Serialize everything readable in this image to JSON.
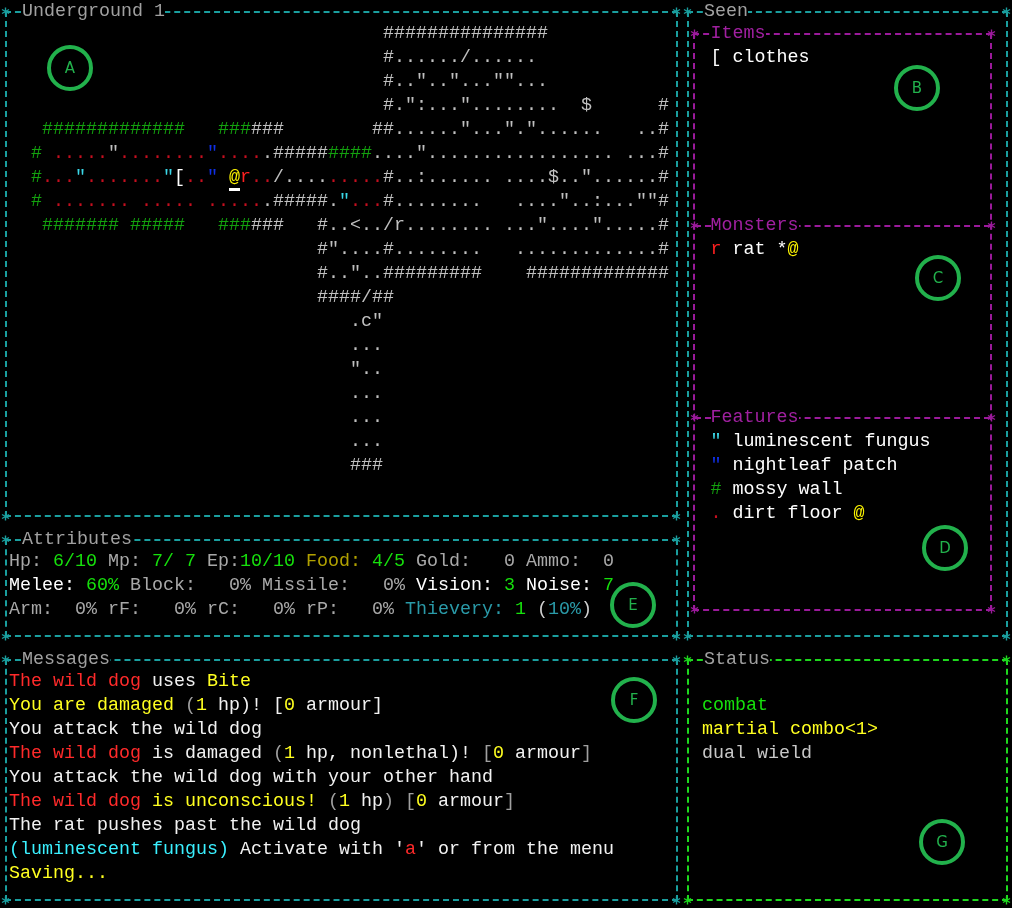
{
  "map_panel": {
    "title": "Underground 1",
    "callout": "A",
    "rows": [
      {
        "segments": [
          {
            "text": "                                  ###############",
            "color": "#c0c0c0"
          }
        ]
      },
      {
        "segments": [
          {
            "text": "                                  #....../......",
            "color": "#c0c0c0"
          }
        ]
      },
      {
        "segments": [
          {
            "text": "                                  #..\"..\"...\"\"...",
            "color": "#c0c0c0"
          }
        ]
      },
      {
        "segments": [
          {
            "text": "                                  #.\":...\"........  $      #",
            "color": "#c0c0c0"
          }
        ]
      },
      {
        "segments": [
          {
            "text": "   #############",
            "color": "#13a10e"
          },
          {
            "text": "   ###",
            "color": "#13a10e"
          },
          {
            "text": "###",
            "color": "#c0c0c0"
          },
          {
            "text": "        ##......\"...\".\"......   ..#",
            "color": "#c0c0c0"
          }
        ]
      },
      {
        "segments": [
          {
            "text": "  #",
            "color": "#13a10e"
          },
          {
            "text": " .....",
            "color": "#c50f1f"
          },
          {
            "text": "\"",
            "color": "#c0c0c0"
          },
          {
            "text": "........",
            "color": "#c50f1f"
          },
          {
            "text": "\"",
            "color": "#1030e8"
          },
          {
            "text": "....",
            "color": "#c50f1f"
          },
          {
            "text": ".#####",
            "color": "#c0c0c0"
          },
          {
            "text": "####",
            "color": "#13a10e"
          },
          {
            "text": "....\"................. ...#",
            "color": "#c0c0c0"
          }
        ]
      },
      {
        "segments": [
          {
            "text": "  #",
            "color": "#13a10e"
          },
          {
            "text": "...",
            "color": "#c50f1f"
          },
          {
            "text": "\"",
            "color": "#3ad8e8"
          },
          {
            "text": ".......",
            "color": "#c50f1f"
          },
          {
            "text": "\"",
            "color": "#3ad8e8"
          },
          {
            "text": "[",
            "color": "#ffffff"
          },
          {
            "text": "..",
            "color": "#c50f1f"
          },
          {
            "text": "\"",
            "color": "#1030e8"
          },
          {
            "text": " @",
            "color": "#f9f100",
            "cursor": true
          },
          {
            "text": "r",
            "color": "#ff2020"
          },
          {
            "text": "..",
            "color": "#c50f1f"
          },
          {
            "text": "/....",
            "color": "#c0c0c0"
          },
          {
            "text": ".....",
            "color": "#c50f1f"
          },
          {
            "text": "#..:...... ....$..\"......#",
            "color": "#c0c0c0"
          }
        ]
      },
      {
        "segments": [
          {
            "text": "  #",
            "color": "#13a10e"
          },
          {
            "text": " .......",
            "color": "#c50f1f"
          },
          {
            "text": " .....",
            "color": "#c50f1f"
          },
          {
            "text": " .....",
            "color": "#c50f1f"
          },
          {
            "text": ".#####.",
            "color": "#c0c0c0"
          },
          {
            "text": "\"",
            "color": "#3ad8e8"
          },
          {
            "text": "...",
            "color": "#c50f1f"
          },
          {
            "text": "#........   ....\"..:...\"\"#",
            "color": "#c0c0c0"
          }
        ]
      },
      {
        "segments": [
          {
            "text": "   #######",
            "color": "#13a10e"
          },
          {
            "text": " #####",
            "color": "#13a10e"
          },
          {
            "text": "   ###",
            "color": "#13a10e"
          },
          {
            "text": "###",
            "color": "#c0c0c0"
          },
          {
            "text": "   #..<../r........ ...\"....\".....#",
            "color": "#c0c0c0"
          }
        ]
      },
      {
        "segments": [
          {
            "text": "                            #\"....#........   .............#",
            "color": "#c0c0c0"
          }
        ]
      },
      {
        "segments": [
          {
            "text": "                            #..\"..#########    #############",
            "color": "#c0c0c0"
          }
        ]
      },
      {
        "segments": [
          {
            "text": "                            ####/##",
            "color": "#c0c0c0"
          }
        ]
      },
      {
        "segments": [
          {
            "text": "                               .c\"",
            "color": "#c0c0c0"
          }
        ]
      },
      {
        "segments": [
          {
            "text": "                               ...",
            "color": "#c0c0c0"
          }
        ]
      },
      {
        "segments": [
          {
            "text": "                               \"..",
            "color": "#c0c0c0"
          }
        ]
      },
      {
        "segments": [
          {
            "text": "                               ...",
            "color": "#c0c0c0"
          }
        ]
      },
      {
        "segments": [
          {
            "text": "                               ...",
            "color": "#c0c0c0"
          }
        ]
      },
      {
        "segments": [
          {
            "text": "                               ...",
            "color": "#c0c0c0"
          }
        ]
      },
      {
        "segments": [
          {
            "text": "                               ###",
            "color": "#c0c0c0"
          }
        ]
      }
    ]
  },
  "attributes_panel": {
    "title": "Attributes",
    "callout": "E",
    "rows": [
      {
        "segments": [
          {
            "text": "Hp: ",
            "color": "#a8a8a8"
          },
          {
            "text": "6/10",
            "color": "#16e00c"
          },
          {
            "text": " Mp: ",
            "color": "#a8a8a8"
          },
          {
            "text": "7/ 7",
            "color": "#16e00c"
          },
          {
            "text": " Ep:",
            "color": "#a8a8a8"
          },
          {
            "text": "10/10",
            "color": "#16e00c"
          },
          {
            "text": " Food: ",
            "color": "#b0a000"
          },
          {
            "text": "4/5",
            "color": "#16e00c"
          },
          {
            "text": " Gold:   0 Ammo:  0",
            "color": "#a8a8a8"
          }
        ]
      },
      {
        "segments": [
          {
            "text": "Melee: ",
            "color": "#ffffff"
          },
          {
            "text": "60%",
            "color": "#16e00c"
          },
          {
            "text": " Block:   0% Missile:   0% ",
            "color": "#a8a8a8"
          },
          {
            "text": "Vision: ",
            "color": "#ffffff"
          },
          {
            "text": "3",
            "color": "#16e00c"
          },
          {
            "text": " Noise: ",
            "color": "#ffffff"
          },
          {
            "text": "7",
            "color": "#16e00c"
          }
        ]
      },
      {
        "segments": [
          {
            "text": "Arm:  0% rF:   0% rC:   0% rP:   0% ",
            "color": "#a8a8a8"
          },
          {
            "text": "Thievery: ",
            "color": "#2a9aa8"
          },
          {
            "text": "1",
            "color": "#16e00c"
          },
          {
            "text": " (",
            "color": "#d0d0d0"
          },
          {
            "text": "10%",
            "color": "#2a9aa8"
          },
          {
            "text": ")",
            "color": "#d0d0d0"
          }
        ]
      }
    ]
  },
  "messages_panel": {
    "title": "Messages",
    "callout": "F",
    "lines": [
      {
        "segments": [
          {
            "text": "The wild dog",
            "color": "#ff2a2a"
          },
          {
            "text": " uses ",
            "color": "#f2f2f2"
          },
          {
            "text": "Bite",
            "color": "#ffff20"
          }
        ]
      },
      {
        "segments": [
          {
            "text": "You are damaged",
            "color": "#ffff20"
          },
          {
            "text": " (",
            "color": "#a0a0a0"
          },
          {
            "text": "1",
            "color": "#ffff20"
          },
          {
            "text": " hp)! [",
            "color": "#f2f2f2"
          },
          {
            "text": "0",
            "color": "#ffff20"
          },
          {
            "text": " armour]",
            "color": "#f2f2f2"
          }
        ]
      },
      {
        "segments": [
          {
            "text": "You attack the wild dog",
            "color": "#f2f2f2"
          }
        ]
      },
      {
        "segments": [
          {
            "text": "The wild dog",
            "color": "#ff2a2a"
          },
          {
            "text": " is damaged ",
            "color": "#f2f2f2"
          },
          {
            "text": "(",
            "color": "#a0a0a0"
          },
          {
            "text": "1",
            "color": "#ffff20"
          },
          {
            "text": " hp, nonlethal)! ",
            "color": "#f2f2f2"
          },
          {
            "text": "[",
            "color": "#a0a0a0"
          },
          {
            "text": "0",
            "color": "#ffff20"
          },
          {
            "text": " armour",
            "color": "#f2f2f2"
          },
          {
            "text": "]",
            "color": "#a0a0a0"
          }
        ]
      },
      {
        "segments": [
          {
            "text": "You attack the wild dog with your other hand",
            "color": "#f2f2f2"
          }
        ]
      },
      {
        "segments": [
          {
            "text": "The wild dog",
            "color": "#ff2a2a"
          },
          {
            "text": " is unconscious! ",
            "color": "#ffff20"
          },
          {
            "text": "(",
            "color": "#a0a0a0"
          },
          {
            "text": "1",
            "color": "#ffff20"
          },
          {
            "text": " hp",
            "color": "#f2f2f2"
          },
          {
            "text": ") [",
            "color": "#a0a0a0"
          },
          {
            "text": "0",
            "color": "#ffff20"
          },
          {
            "text": " armour",
            "color": "#f2f2f2"
          },
          {
            "text": "]",
            "color": "#a0a0a0"
          }
        ]
      },
      {
        "segments": [
          {
            "text": "The rat pushes past the wild dog",
            "color": "#f2f2f2"
          }
        ]
      },
      {
        "segments": [
          {
            "text": "(luminescent fungus)",
            "color": "#3af0ff"
          },
          {
            "text": " Activate with '",
            "color": "#f2f2f2"
          },
          {
            "text": "a",
            "color": "#ff2a2a"
          },
          {
            "text": "' or from the menu",
            "color": "#f2f2f2"
          }
        ]
      },
      {
        "segments": [
          {
            "text": "Saving...",
            "color": "#ffff20"
          }
        ]
      }
    ]
  },
  "seen_panel": {
    "title": "Seen",
    "sections": [
      {
        "title": "Items",
        "callout": "B",
        "entries": [
          {
            "segments": [
              {
                "text": "[ clothes",
                "color": "#ffffff"
              }
            ]
          }
        ]
      },
      {
        "title": "Monsters",
        "callout": "C",
        "entries": [
          {
            "segments": [
              {
                "text": "r",
                "color": "#ff2020"
              },
              {
                "text": " rat *",
                "color": "#ffffff"
              },
              {
                "text": "@",
                "color": "#f9f100"
              }
            ]
          }
        ]
      },
      {
        "title": "Features",
        "callout": "D",
        "entries": [
          {
            "segments": [
              {
                "text": "\"",
                "color": "#3ad8e8"
              },
              {
                "text": " luminescent fungus",
                "color": "#ffffff"
              }
            ]
          },
          {
            "segments": [
              {
                "text": "\"",
                "color": "#1030e8"
              },
              {
                "text": " nightleaf patch",
                "color": "#ffffff"
              }
            ]
          },
          {
            "segments": [
              {
                "text": "#",
                "color": "#13a10e"
              },
              {
                "text": " mossy wall",
                "color": "#ffffff"
              }
            ]
          },
          {
            "segments": [
              {
                "text": ".",
                "color": "#c50f1f"
              },
              {
                "text": " dirt floor ",
                "color": "#ffffff"
              },
              {
                "text": "@",
                "color": "#f9f100"
              }
            ]
          }
        ]
      }
    ]
  },
  "status_panel": {
    "title": "Status",
    "callout": "G",
    "lines": [
      {
        "text": "combat",
        "color": "#16e00c"
      },
      {
        "text": "martial combo<1>",
        "color": "#ffff20"
      },
      {
        "text": "dual wield",
        "color": "#c8c8c8"
      }
    ]
  }
}
